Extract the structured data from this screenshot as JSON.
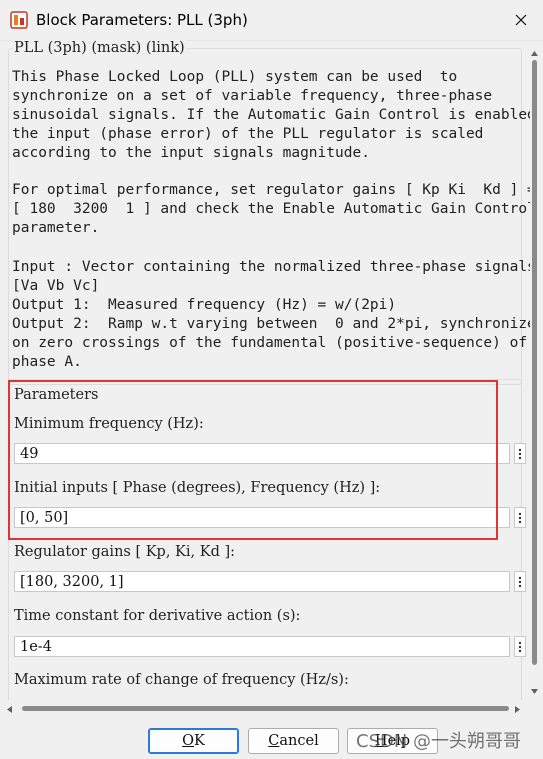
{
  "window": {
    "title": "Block Parameters: PLL (3ph)"
  },
  "mask": {
    "legend": "PLL (3ph) (mask) (link)",
    "description_1": "This Phase Locked Loop (PLL) system can be used  to\nsynchronize on a set of variable frequency, three-phase\nsinusoidal signals. If the Automatic Gain Control is enabled\nthe input (phase error) of the PLL regulator is scaled\naccording to the input signals magnitude.",
    "description_2": "For optimal performance, set regulator gains [ Kp Ki  Kd ] =\n[ 180  3200  1 ] and check the Enable Automatic Gain Control\nparameter.",
    "description_3": "Input : Vector containing the normalized three-phase signals\n[Va Vb Vc]\nOutput 1:  Measured frequency (Hz) = w/(2pi)\nOutput 2:  Ramp w.t varying between  0 and 2*pi, synchronize\non zero crossings of the fundamental (positive-sequence) of\nphase A."
  },
  "parameters": {
    "legend": "Parameters",
    "fields": [
      {
        "label": "Minimum frequency (Hz):",
        "value": "49"
      },
      {
        "label": "Initial inputs [ Phase (degrees), Frequency (Hz) ]:",
        "value": "[0, 50]"
      },
      {
        "label": "Regulator gains [ Kp, Ki, Kd ]:",
        "value": "[180, 3200, 1]"
      },
      {
        "label": "Time constant for derivative action (s):",
        "value": "1e-4"
      },
      {
        "label": "Maximum rate of change of frequency (Hz/s):",
        "value": ""
      }
    ]
  },
  "buttons": {
    "ok": {
      "mnemonic": "O",
      "rest": "K"
    },
    "cancel": {
      "mnemonic": "C",
      "rest": "ancel"
    },
    "help": {
      "mnemonic": "H",
      "rest": "elp"
    }
  },
  "watermark": "CSDN @一头朔哥哥",
  "colors": {
    "highlight_border": "#e03535",
    "default_button_border": "#2c7ad6",
    "window_bg": "#f0f0f0"
  },
  "icons": [
    "simulink-block-icon",
    "close-icon",
    "more-options-icon",
    "scroll-arrow-icon"
  ]
}
